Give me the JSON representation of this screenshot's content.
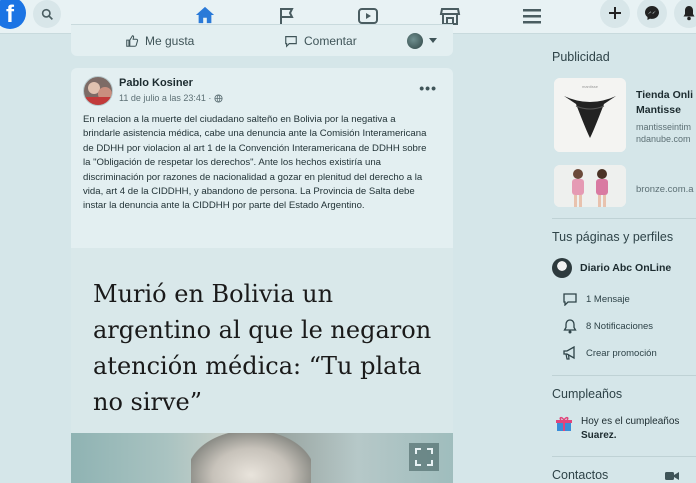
{
  "nav": {
    "logo": "f",
    "tabs": [
      "home",
      "flag",
      "watch",
      "marketplace",
      "menu"
    ]
  },
  "prev_post_actions": {
    "like": "Me gusta",
    "comment": "Comentar"
  },
  "post": {
    "author": "Pablo Kosiner",
    "date": "11 de julio a las 23:41 ·",
    "more": "•••",
    "text": "En relacion a la muerte del ciudadano salteño en Bolivia por la negativa a brindarle asistencia médica, cabe una denuncia ante la Comisión Interamericana de DDHH por violacion al art 1 de la Convención Interamericana de DDHH sobre la \"Obligación de respetar los derechos\".  Ante los hechos existiría una discriminación por razones de nacionalidad a gozar en plenitud del derecho a la vida, art 4 de la CIDDHH, y abandono de persona. La Provincia de Salta debe instar la denuncia ante la CIDDHH por parte del Estado Argentino.",
    "headline": "Murió en Bolivia un argentino al que le negaron atención médica: “Tu plata no sirve”"
  },
  "sidebar": {
    "ads_title": "Publicidad",
    "ads": [
      {
        "name": "Tienda Onli",
        "name2": "Mantisse",
        "domain": "mantisseintim",
        "domain2": "ndanube.com"
      },
      {
        "domain": "bronze.com.a"
      }
    ],
    "pages_title": "Tus páginas y perfiles",
    "page_name": "Diario Abc OnLine",
    "page_items": [
      "1 Mensaje",
      "8 Notificaciones",
      "Crear promoción"
    ],
    "birthday_title": "Cumpleaños",
    "birthday_text_1": "Hoy es el cumpleaños",
    "birthday_text_2": "Suarez.",
    "contacts_title": "Contactos"
  },
  "colors": {
    "accent": "#2a7ad8",
    "background": "#d5e6e9",
    "card": "#e3eff1"
  }
}
